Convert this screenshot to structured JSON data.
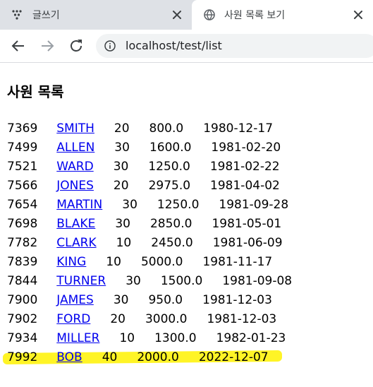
{
  "tabs": [
    {
      "title": "글쓰기",
      "active": false,
      "icon": "app-dots-icon"
    },
    {
      "title": "사원 목록 보기",
      "active": true,
      "icon": "globe-icon"
    }
  ],
  "toolbar": {
    "url": "localhost/test/list",
    "back_icon": "arrow-left-icon",
    "forward_icon": "arrow-right-icon",
    "reload_icon": "reload-icon",
    "info_icon": "info-icon"
  },
  "page": {
    "title": "사원 목록"
  },
  "employees": [
    {
      "empno": "7369",
      "ename": "SMITH",
      "deptno": "20",
      "sal": "800.0",
      "hiredate": "1980-12-17"
    },
    {
      "empno": "7499",
      "ename": "ALLEN",
      "deptno": "30",
      "sal": "1600.0",
      "hiredate": "1981-02-20"
    },
    {
      "empno": "7521",
      "ename": "WARD",
      "deptno": "30",
      "sal": "1250.0",
      "hiredate": "1981-02-22"
    },
    {
      "empno": "7566",
      "ename": "JONES",
      "deptno": "20",
      "sal": "2975.0",
      "hiredate": "1981-04-02"
    },
    {
      "empno": "7654",
      "ename": "MARTIN",
      "deptno": "30",
      "sal": "1250.0",
      "hiredate": "1981-09-28"
    },
    {
      "empno": "7698",
      "ename": "BLAKE",
      "deptno": "30",
      "sal": "2850.0",
      "hiredate": "1981-05-01"
    },
    {
      "empno": "7782",
      "ename": "CLARK",
      "deptno": "10",
      "sal": "2450.0",
      "hiredate": "1981-06-09"
    },
    {
      "empno": "7839",
      "ename": "KING",
      "deptno": "10",
      "sal": "5000.0",
      "hiredate": "1981-11-17"
    },
    {
      "empno": "7844",
      "ename": "TURNER",
      "deptno": "30",
      "sal": "1500.0",
      "hiredate": "1981-09-08"
    },
    {
      "empno": "7900",
      "ename": "JAMES",
      "deptno": "30",
      "sal": "950.0",
      "hiredate": "1981-12-03"
    },
    {
      "empno": "7902",
      "ename": "FORD",
      "deptno": "20",
      "sal": "3000.0",
      "hiredate": "1981-12-03"
    },
    {
      "empno": "7934",
      "ename": "MILLER",
      "deptno": "10",
      "sal": "1300.0",
      "hiredate": "1982-01-23"
    },
    {
      "empno": "7992",
      "ename": "BOB",
      "deptno": "40",
      "sal": "2000.0",
      "hiredate": "2022-12-07"
    }
  ],
  "highlight_color": "#fff200"
}
